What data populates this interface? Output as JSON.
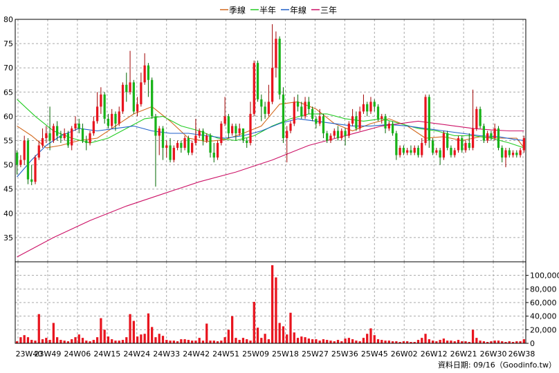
{
  "chart_data": {
    "type": "candlestick",
    "legend": {
      "placement": "top-center",
      "items": [
        {
          "label": "季線",
          "color": "#d2691e"
        },
        {
          "label": "半年",
          "color": "#22cc22"
        },
        {
          "label": "年線",
          "color": "#1f5fc8"
        },
        {
          "label": "三年",
          "color": "#cc1166"
        }
      ]
    },
    "price_axis": {
      "ylim": [
        30,
        80
      ],
      "ticks": [
        35,
        40,
        45,
        50,
        55,
        60,
        65,
        70,
        75,
        80
      ]
    },
    "volume_axis": {
      "ylim": [
        0,
        120000
      ],
      "ticks": [
        "0",
        "20,000",
        "40,000",
        "60,000",
        "80,000",
        "100,000"
      ],
      "tick_values": [
        0,
        20000,
        40000,
        60000,
        80000,
        100000
      ]
    },
    "x_ticks": [
      "23W40",
      "23W49",
      "24W06",
      "24W15",
      "24W24",
      "24W33",
      "24W42",
      "24W51",
      "25W09",
      "25W18",
      "25W27",
      "25W36",
      "25W45",
      "26W02",
      "26W12",
      "26W21",
      "26W30",
      "26W38"
    ],
    "grid": true,
    "source_text": "資料日期: 09/16（Goodinfo.tw）",
    "candles": [
      [
        52.5,
        50.0,
        48.0,
        53.0
      ],
      [
        50.0,
        51.0,
        49.5,
        52.0
      ],
      [
        51.0,
        55.0,
        50.0,
        56.0
      ],
      [
        55.0,
        47.0,
        46.0,
        55.5
      ],
      [
        47.0,
        46.5,
        45.8,
        50.0
      ],
      [
        46.5,
        51.5,
        46.0,
        52.0
      ],
      [
        51.5,
        54.0,
        51.0,
        55.0
      ],
      [
        54.0,
        55.5,
        53.5,
        57.5
      ],
      [
        55.5,
        56.5,
        54.5,
        58.0
      ],
      [
        56.5,
        55.0,
        53.0,
        62.0
      ],
      [
        55.0,
        58.0,
        54.5,
        58.5
      ],
      [
        58.0,
        56.0,
        55.0,
        59.0
      ],
      [
        56.0,
        55.5,
        54.5,
        57.0
      ],
      [
        55.5,
        56.5,
        55.0,
        57.5
      ],
      [
        56.5,
        54.0,
        53.5,
        57.0
      ],
      [
        54.0,
        57.5,
        53.0,
        58.0
      ],
      [
        57.5,
        58.5,
        57.0,
        60.0
      ],
      [
        58.5,
        57.5,
        56.5,
        59.5
      ],
      [
        57.5,
        55.0,
        54.5,
        58.5
      ],
      [
        55.0,
        54.5,
        53.0,
        56.0
      ],
      [
        54.5,
        56.5,
        54.0,
        57.0
      ],
      [
        56.5,
        59.0,
        56.0,
        60.0
      ],
      [
        59.0,
        62.0,
        58.5,
        65.0
      ],
      [
        62.0,
        64.5,
        60.5,
        66.0
      ],
      [
        64.5,
        59.5,
        58.5,
        65.0
      ],
      [
        59.5,
        58.0,
        57.5,
        60.5
      ],
      [
        58.0,
        60.5,
        57.5,
        61.5
      ],
      [
        60.5,
        58.5,
        57.0,
        61.0
      ],
      [
        58.5,
        61.0,
        58.0,
        62.0
      ],
      [
        61.0,
        66.5,
        60.5,
        67.0
      ],
      [
        66.5,
        65.0,
        63.0,
        69.0
      ],
      [
        65.0,
        67.0,
        64.5,
        73.5
      ],
      [
        67.0,
        61.0,
        60.5,
        67.5
      ],
      [
        61.0,
        62.5,
        60.0,
        64.0
      ],
      [
        62.5,
        67.0,
        62.0,
        69.0
      ],
      [
        67.0,
        70.5,
        66.5,
        73.0
      ],
      [
        70.5,
        67.5,
        64.0,
        71.0
      ],
      [
        67.5,
        60.0,
        59.5,
        68.0
      ],
      [
        60.0,
        56.0,
        45.5,
        60.5
      ],
      [
        56.0,
        57.5,
        52.0,
        58.0
      ],
      [
        57.5,
        53.5,
        51.0,
        58.0
      ],
      [
        53.5,
        54.0,
        51.5,
        55.0
      ],
      [
        54.0,
        51.0,
        50.5,
        55.5
      ],
      [
        51.0,
        53.5,
        50.5,
        54.0
      ],
      [
        53.5,
        54.5,
        53.0,
        55.0
      ],
      [
        54.5,
        53.5,
        52.5,
        55.0
      ],
      [
        53.5,
        55.5,
        53.0,
        56.0
      ],
      [
        55.5,
        52.5,
        52.0,
        56.0
      ],
      [
        52.5,
        54.5,
        52.0,
        55.0
      ],
      [
        54.5,
        56.0,
        54.0,
        59.5
      ],
      [
        56.0,
        57.0,
        55.5,
        57.5
      ],
      [
        57.0,
        55.0,
        54.0,
        57.5
      ],
      [
        55.0,
        56.0,
        54.5,
        56.5
      ],
      [
        56.0,
        52.5,
        51.5,
        56.5
      ],
      [
        52.5,
        51.5,
        50.5,
        54.5
      ],
      [
        51.5,
        54.5,
        51.0,
        55.0
      ],
      [
        54.5,
        58.5,
        54.0,
        59.0
      ],
      [
        58.5,
        60.0,
        58.0,
        64.0
      ],
      [
        60.0,
        56.5,
        55.5,
        60.5
      ],
      [
        56.5,
        58.0,
        56.0,
        58.5
      ],
      [
        58.0,
        56.5,
        55.0,
        58.5
      ],
      [
        56.5,
        57.5,
        56.0,
        58.5
      ],
      [
        57.5,
        55.0,
        54.5,
        57.5
      ],
      [
        55.0,
        54.5,
        53.5,
        55.5
      ],
      [
        54.5,
        60.5,
        54.0,
        63.0
      ],
      [
        60.5,
        71.0,
        60.0,
        71.5
      ],
      [
        71.0,
        63.5,
        63.0,
        71.5
      ],
      [
        63.5,
        62.0,
        59.0,
        64.5
      ],
      [
        62.0,
        60.5,
        59.5,
        63.0
      ],
      [
        60.5,
        63.0,
        60.0,
        66.5
      ],
      [
        63.0,
        70.0,
        62.5,
        79.0
      ],
      [
        70.0,
        76.0,
        68.0,
        77.5
      ],
      [
        76.0,
        64.5,
        63.5,
        76.5
      ],
      [
        64.5,
        55.5,
        54.5,
        66.0
      ],
      [
        55.5,
        57.0,
        50.5,
        58.0
      ],
      [
        57.0,
        58.5,
        56.5,
        59.0
      ],
      [
        58.5,
        63.0,
        58.0,
        64.0
      ],
      [
        63.0,
        62.0,
        61.0,
        64.5
      ],
      [
        62.0,
        60.0,
        59.5,
        63.0
      ],
      [
        60.0,
        63.0,
        59.5,
        64.0
      ],
      [
        63.0,
        61.5,
        60.5,
        64.0
      ],
      [
        61.5,
        59.5,
        59.0,
        62.0
      ],
      [
        59.5,
        58.5,
        57.5,
        60.0
      ],
      [
        58.5,
        60.0,
        58.0,
        61.5
      ],
      [
        60.0,
        56.5,
        55.5,
        60.5
      ],
      [
        56.5,
        55.0,
        54.5,
        57.0
      ],
      [
        55.0,
        56.0,
        54.5,
        56.5
      ],
      [
        56.0,
        57.0,
        55.5,
        57.5
      ],
      [
        57.0,
        55.5,
        55.0,
        58.0
      ],
      [
        55.5,
        57.0,
        55.0,
        57.5
      ],
      [
        57.0,
        56.0,
        54.0,
        57.5
      ],
      [
        56.0,
        58.5,
        55.5,
        59.0
      ],
      [
        58.5,
        60.0,
        58.0,
        61.5
      ],
      [
        60.0,
        57.5,
        57.0,
        61.0
      ],
      [
        57.5,
        61.0,
        57.0,
        62.0
      ],
      [
        61.0,
        62.5,
        60.5,
        64.5
      ],
      [
        62.5,
        61.0,
        60.0,
        63.0
      ],
      [
        61.0,
        63.0,
        60.5,
        64.0
      ],
      [
        63.0,
        62.0,
        61.0,
        63.5
      ],
      [
        62.0,
        59.5,
        59.0,
        62.5
      ],
      [
        59.5,
        60.0,
        58.5,
        60.5
      ],
      [
        60.0,
        57.5,
        56.5,
        60.5
      ],
      [
        57.5,
        58.5,
        57.0,
        59.0
      ],
      [
        58.5,
        56.5,
        56.0,
        59.0
      ],
      [
        56.5,
        52.0,
        51.0,
        57.0
      ],
      [
        52.0,
        53.5,
        51.5,
        54.0
      ],
      [
        53.5,
        52.5,
        52.0,
        54.0
      ],
      [
        52.5,
        53.0,
        52.0,
        53.5
      ],
      [
        53.0,
        52.5,
        52.0,
        54.0
      ],
      [
        52.5,
        53.5,
        52.0,
        54.0
      ],
      [
        53.5,
        52.0,
        51.5,
        54.0
      ],
      [
        52.0,
        54.5,
        51.5,
        55.5
      ],
      [
        54.5,
        64.0,
        54.0,
        64.5
      ],
      [
        64.0,
        55.0,
        53.5,
        64.5
      ],
      [
        55.0,
        52.5,
        52.0,
        55.5
      ],
      [
        52.5,
        53.0,
        52.0,
        53.5
      ],
      [
        53.0,
        51.5,
        50.0,
        53.5
      ],
      [
        51.5,
        56.5,
        51.0,
        57.0
      ],
      [
        56.5,
        53.5,
        53.0,
        57.0
      ],
      [
        53.5,
        52.0,
        51.5,
        54.0
      ],
      [
        52.0,
        53.0,
        51.5,
        53.5
      ],
      [
        53.0,
        55.5,
        52.5,
        56.0
      ],
      [
        55.5,
        53.0,
        52.5,
        56.0
      ],
      [
        53.0,
        54.5,
        52.5,
        55.0
      ],
      [
        54.5,
        53.5,
        53.0,
        56.5
      ],
      [
        53.5,
        57.5,
        53.0,
        65.5
      ],
      [
        57.5,
        61.5,
        57.0,
        62.0
      ],
      [
        61.5,
        58.0,
        57.5,
        62.0
      ],
      [
        58.0,
        55.0,
        54.5,
        58.5
      ],
      [
        55.0,
        56.5,
        54.5,
        57.0
      ],
      [
        56.5,
        55.5,
        55.0,
        57.0
      ],
      [
        55.5,
        57.5,
        55.0,
        58.5
      ],
      [
        57.5,
        53.5,
        53.0,
        58.0
      ],
      [
        53.5,
        51.5,
        50.5,
        54.0
      ],
      [
        51.5,
        53.0,
        49.5,
        53.5
      ],
      [
        53.0,
        52.0,
        51.5,
        53.5
      ],
      [
        52.0,
        52.5,
        51.5,
        53.0
      ],
      [
        52.5,
        52.0,
        51.5,
        53.0
      ],
      [
        52.0,
        53.0,
        51.5,
        53.5
      ],
      [
        53.0,
        55.5,
        52.5,
        56.0
      ]
    ],
    "volume": [
      3000,
      9000,
      12000,
      9000,
      5000,
      4000,
      43000,
      6000,
      8000,
      5000,
      30000,
      9000,
      5000,
      4000,
      3000,
      6000,
      9000,
      13000,
      8000,
      4000,
      3000,
      5000,
      9000,
      37000,
      20000,
      10000,
      6000,
      4000,
      4000,
      5000,
      9000,
      43000,
      33000,
      10000,
      13000,
      14000,
      44000,
      24000,
      9000,
      14000,
      11000,
      5000,
      4000,
      4000,
      3000,
      6000,
      6000,
      5000,
      4000,
      4000,
      8000,
      4000,
      29000,
      4000,
      4000,
      3000,
      4000,
      9000,
      20000,
      40000,
      8000,
      5000,
      8000,
      6000,
      4000,
      61000,
      23000,
      8000,
      14000,
      6000,
      115000,
      97000,
      30000,
      25000,
      13000,
      45000,
      16000,
      8000,
      10000,
      9000,
      7000,
      6000,
      6000,
      4000,
      6000,
      5000,
      4000,
      3000,
      5000,
      3000,
      7000,
      8000,
      6000,
      4000,
      3000,
      8000,
      14000,
      22000,
      12000,
      6000,
      5000,
      4000,
      4000,
      3000,
      3000,
      2000,
      3000,
      3000,
      2000,
      2000,
      5000,
      8000,
      14000,
      6000,
      4000,
      3000,
      5000,
      7000,
      4000,
      4000,
      3000,
      5000,
      3000,
      3000,
      2000,
      20000,
      8000,
      4000,
      3000,
      2000,
      3000,
      4000,
      4000,
      3000,
      2000,
      3000,
      2000,
      3000,
      3000,
      6000
    ],
    "ma_season": [
      [
        0,
        58.0
      ],
      [
        4,
        56.0
      ],
      [
        8,
        53.5
      ],
      [
        12,
        54.0
      ],
      [
        17,
        55.0
      ],
      [
        22,
        55.5
      ],
      [
        27,
        58.0
      ],
      [
        32,
        60.5
      ],
      [
        37,
        62.0
      ],
      [
        42,
        59.0
      ],
      [
        47,
        55.5
      ],
      [
        52,
        54.8
      ],
      [
        57,
        55.2
      ],
      [
        62,
        56.5
      ],
      [
        67,
        58.0
      ],
      [
        72,
        62.5
      ],
      [
        77,
        63.0
      ],
      [
        82,
        61.5
      ],
      [
        87,
        58.5
      ],
      [
        92,
        57.0
      ],
      [
        97,
        58.5
      ],
      [
        102,
        59.5
      ],
      [
        107,
        58.0
      ],
      [
        112,
        55.5
      ],
      [
        117,
        55.8
      ],
      [
        122,
        55.0
      ],
      [
        127,
        55.8
      ],
      [
        132,
        55.5
      ],
      [
        137,
        55.5
      ],
      [
        139,
        53.5
      ]
    ],
    "ma_half": [
      [
        0,
        63.5
      ],
      [
        5,
        60.0
      ],
      [
        10,
        57.0
      ],
      [
        15,
        55.5
      ],
      [
        20,
        54.5
      ],
      [
        25,
        55.5
      ],
      [
        30,
        57.5
      ],
      [
        35,
        59.5
      ],
      [
        40,
        60.0
      ],
      [
        45,
        58.0
      ],
      [
        50,
        57.0
      ],
      [
        55,
        55.5
      ],
      [
        60,
        55.0
      ],
      [
        65,
        56.0
      ],
      [
        70,
        58.0
      ],
      [
        75,
        59.5
      ],
      [
        80,
        60.5
      ],
      [
        85,
        60.5
      ],
      [
        90,
        59.5
      ],
      [
        95,
        59.0
      ],
      [
        100,
        59.5
      ],
      [
        105,
        58.5
      ],
      [
        110,
        57.5
      ],
      [
        115,
        57.0
      ],
      [
        120,
        56.0
      ],
      [
        125,
        56.0
      ],
      [
        130,
        55.5
      ],
      [
        135,
        54.5
      ],
      [
        139,
        53.5
      ]
    ],
    "ma_year": [
      [
        0,
        47.5
      ],
      [
        4,
        51.0
      ],
      [
        8,
        54.0
      ],
      [
        12,
        56.0
      ],
      [
        17,
        57.5
      ],
      [
        22,
        57.0
      ],
      [
        27,
        57.5
      ],
      [
        32,
        58.0
      ],
      [
        37,
        57.0
      ],
      [
        42,
        56.5
      ],
      [
        47,
        56.5
      ],
      [
        52,
        56.0
      ],
      [
        57,
        55.5
      ],
      [
        62,
        56.0
      ],
      [
        67,
        57.0
      ],
      [
        72,
        58.5
      ],
      [
        77,
        59.5
      ],
      [
        82,
        59.0
      ],
      [
        87,
        58.5
      ],
      [
        92,
        58.0
      ],
      [
        97,
        58.0
      ],
      [
        102,
        58.3
      ],
      [
        107,
        58.0
      ],
      [
        112,
        57.5
      ],
      [
        117,
        57.0
      ],
      [
        122,
        56.5
      ],
      [
        127,
        56.0
      ],
      [
        132,
        55.8
      ],
      [
        136,
        55.3
      ],
      [
        139,
        55.0
      ]
    ],
    "ma_3year": [
      [
        0,
        31.0
      ],
      [
        10,
        35.0
      ],
      [
        20,
        38.5
      ],
      [
        30,
        41.5
      ],
      [
        40,
        44.0
      ],
      [
        50,
        46.5
      ],
      [
        60,
        48.5
      ],
      [
        70,
        51.0
      ],
      [
        75,
        52.5
      ],
      [
        80,
        54.0
      ],
      [
        90,
        56.0
      ],
      [
        100,
        58.0
      ],
      [
        110,
        59.0
      ],
      [
        115,
        58.5
      ],
      [
        120,
        58.0
      ],
      [
        125,
        57.5
      ],
      [
        130,
        57.2
      ],
      [
        135,
        57.0
      ],
      [
        139,
        57.0
      ]
    ]
  }
}
